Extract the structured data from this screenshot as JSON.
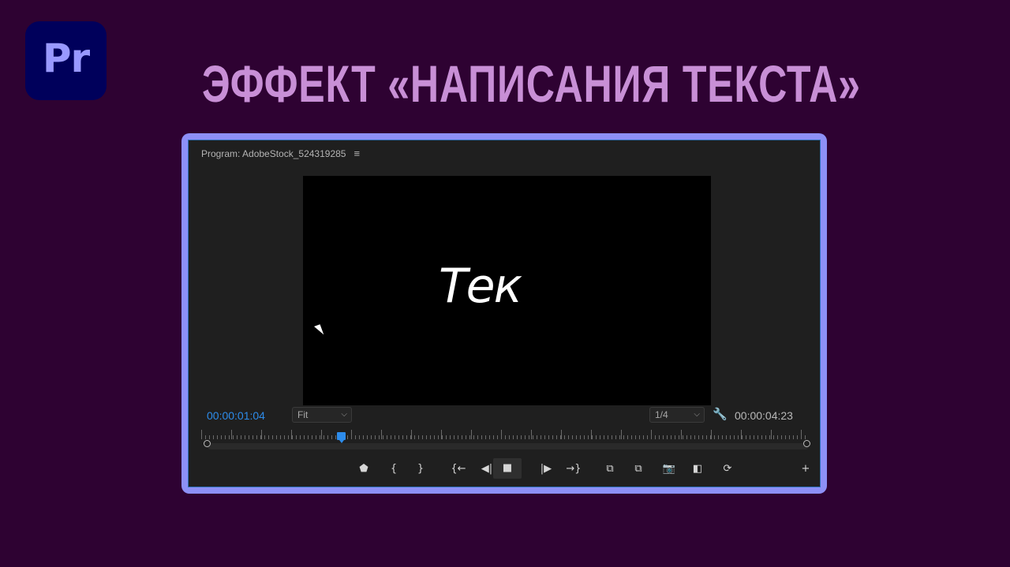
{
  "logo": {
    "text": "Pr"
  },
  "headline": "ЭФФЕКТ «НАПИСАНИЯ ТЕКСТА»",
  "program_panel": {
    "title": "Program: AdobeStock_524319285",
    "menu_icon": "≡",
    "viewer_text": "Тек",
    "current_timecode": "00:00:01:04",
    "zoom_select": {
      "value": "Fit"
    },
    "resolution_select": {
      "value": "1/4"
    },
    "duration_timecode": "00:00:04:23",
    "playhead_fraction": 0.23
  },
  "transport": [
    {
      "name": "add-marker-icon",
      "glyph": "⬟"
    },
    {
      "name": "mark-in-icon",
      "glyph": "{"
    },
    {
      "name": "mark-out-icon",
      "glyph": "}"
    },
    {
      "name": "go-to-in-icon",
      "glyph": "{←"
    },
    {
      "name": "step-back-icon",
      "glyph": "◀|"
    },
    {
      "name": "stop-icon",
      "glyph": "■"
    },
    {
      "name": "step-forward-icon",
      "glyph": "|▶"
    },
    {
      "name": "go-to-out-icon",
      "glyph": "→}"
    },
    {
      "name": "lift-icon",
      "glyph": "⧉"
    },
    {
      "name": "extract-icon",
      "glyph": "⧉"
    },
    {
      "name": "export-frame-icon",
      "glyph": "📷"
    },
    {
      "name": "comparison-view-icon",
      "glyph": "◧"
    },
    {
      "name": "vr-video-icon",
      "glyph": "⟳"
    },
    {
      "name": "add-button-icon",
      "glyph": "+"
    }
  ],
  "colors": {
    "background": "#2e0232",
    "headline": "#c88fd6",
    "frame": "#8d90f7",
    "accent_blue": "#2d8ceb"
  }
}
